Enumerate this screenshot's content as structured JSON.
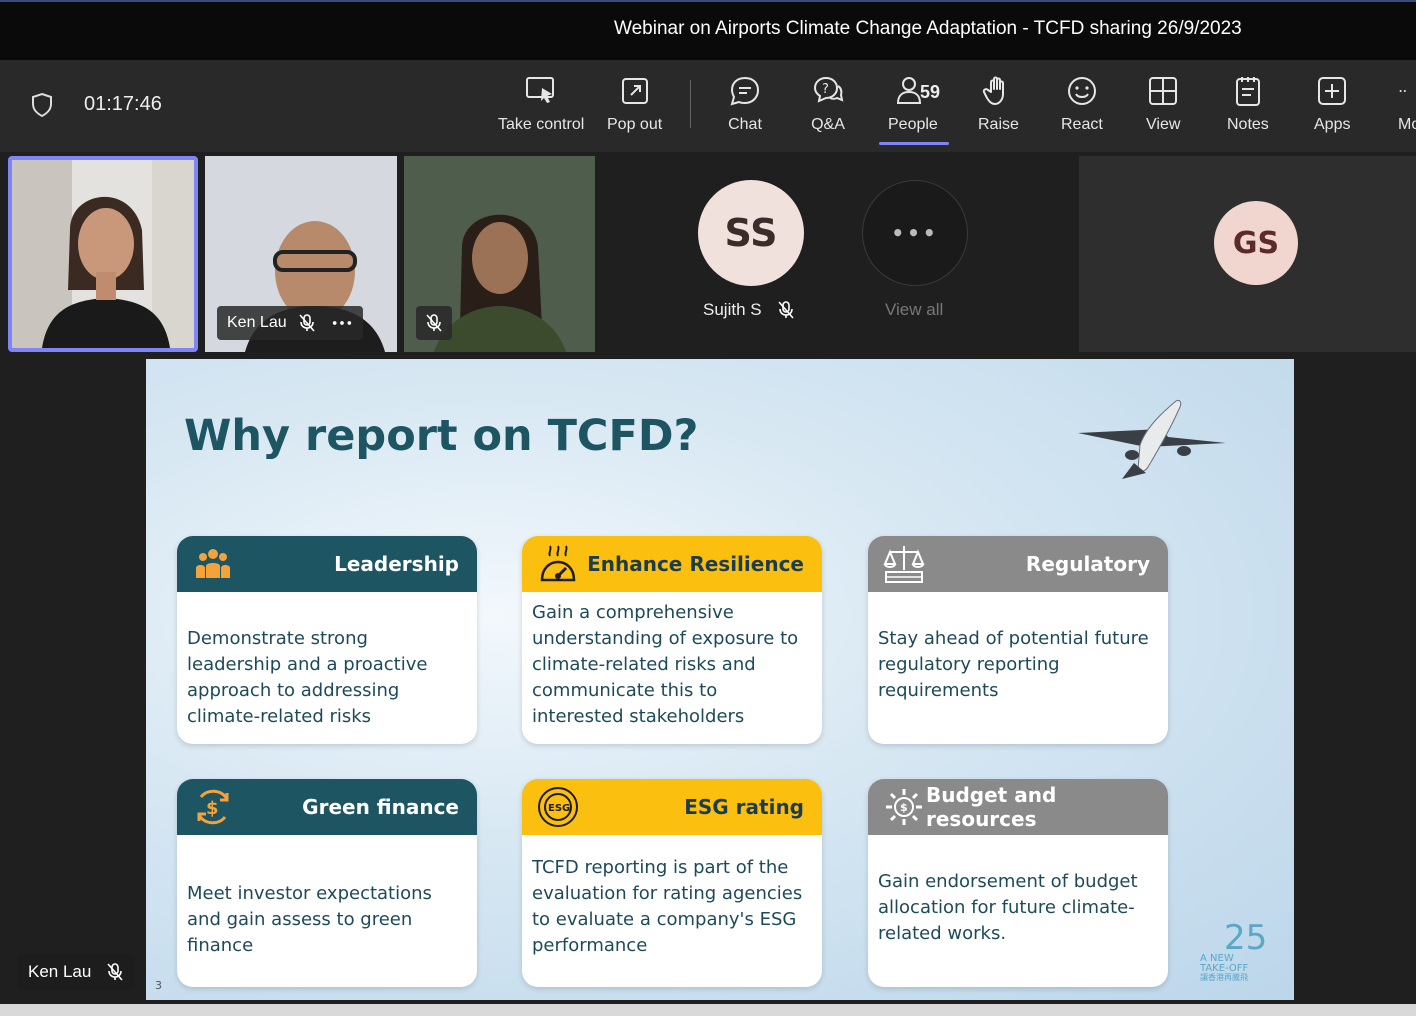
{
  "window": {
    "title": "Webinar on Airports Climate Change Adaptation - TCFD sharing 26/9/2023"
  },
  "toolbar": {
    "timer": "01:17:46",
    "take_control": "Take control",
    "pop_out": "Pop out",
    "chat": "Chat",
    "qa": "Q&A",
    "people": "People",
    "people_count": "59",
    "raise": "Raise",
    "react": "React",
    "view": "View",
    "notes": "Notes",
    "apps": "Apps",
    "more": "Mo"
  },
  "participants": {
    "tile2_name": "Ken Lau",
    "ss_initials": "SS",
    "ss_name": "Sujith S",
    "more_dots": "•••",
    "view_all": "View all",
    "gs_initials": "GS",
    "presenter_name": "Ken Lau"
  },
  "slide": {
    "title": "Why report on TCFD?",
    "page_number": "3",
    "cards": [
      {
        "title": "Leadership",
        "body": "Demonstrate strong leadership and a proactive approach to addressing climate-related risks"
      },
      {
        "title": "Enhance Resilience",
        "body": "Gain a comprehensive understanding of exposure to climate-related risks and communicate this to interested stakeholders"
      },
      {
        "title": "Regulatory",
        "body": "Stay ahead of potential future regulatory reporting requirements"
      },
      {
        "title": "Green finance",
        "body": "Meet investor expectations and gain assess to green finance"
      },
      {
        "title": "ESG rating",
        "body": "TCFD reporting is part of the evaluation for rating agencies to evaluate a company's ESG performance"
      },
      {
        "title": "Budget and resources",
        "body": "Gain endorsement of budget allocation for future climate-related works."
      }
    ],
    "logo": {
      "number": "25",
      "line1": "A NEW",
      "line2": "TAKE-OFF",
      "line3": "讓香港再騰飛"
    },
    "esg_icon_text": "ESG"
  },
  "colors": {
    "teal": "#1d5563",
    "yellow": "#fbbf10",
    "gray": "#8a8a8a",
    "accent": "#7f85f5"
  }
}
